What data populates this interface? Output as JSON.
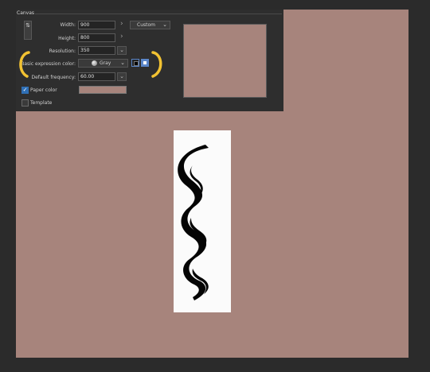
{
  "panel": {
    "title": "Canvas",
    "width_label": "Width:",
    "width_value": "900",
    "height_label": "Height:",
    "height_value": "800",
    "preset_value": "Custom",
    "resolution_label": "Resolution:",
    "resolution_value": "350",
    "basic_expression_label": "Basic expression color:",
    "basic_expression_value": "Gray",
    "default_frequency_label": "Default frequency:",
    "default_frequency_value": "60.00",
    "paper_color_label": "Paper color",
    "paper_color_checked": true,
    "template_label": "Template",
    "template_checked": false
  },
  "colors": {
    "workspace": "#2b2b2b",
    "paper": "#a7847c",
    "page": "#fbfbfb",
    "annotation": "#f2c232",
    "selected_color_highlight": "#5b86c9"
  },
  "icons": {
    "swap": "swap-dimensions-icon",
    "gray_ball": "gray-circle-icon",
    "dropdown": "chevron-down-icon",
    "next": "chevron-right-icon",
    "check": "checkmark-icon"
  }
}
